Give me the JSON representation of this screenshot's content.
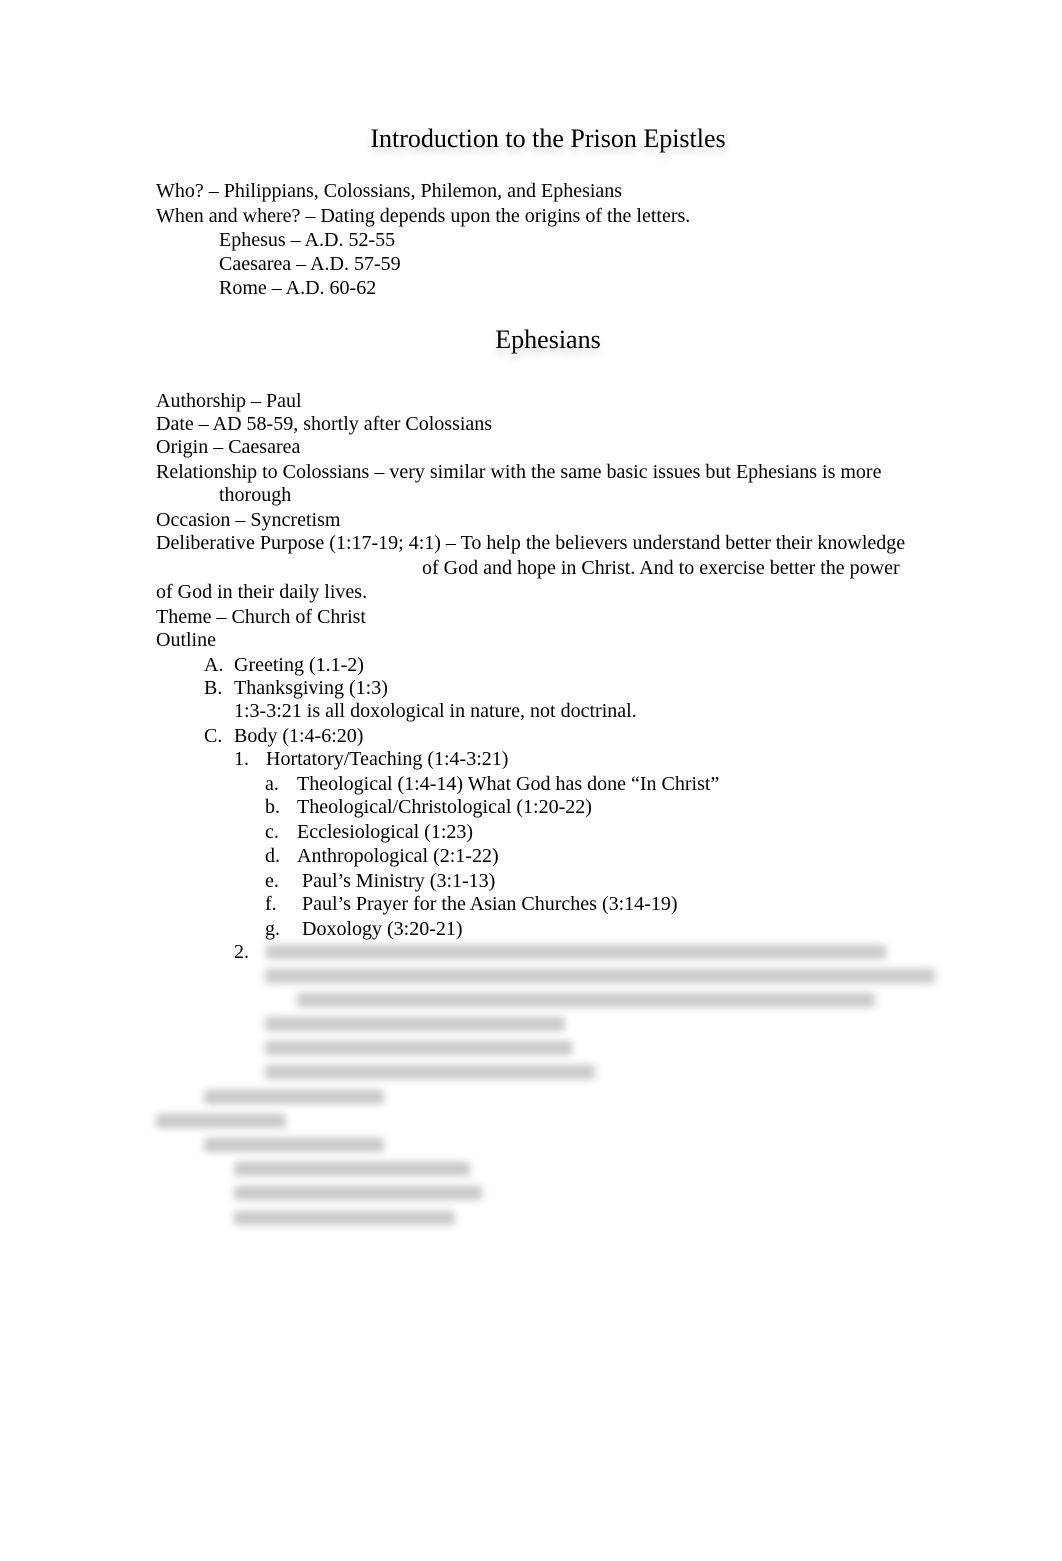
{
  "title": "Introduction to the Prison Epistles",
  "intro": {
    "who": "Who? – Philippians, Colossians, Philemon, and Ephesians",
    "when": "When and where? – Dating depends upon the origins of the letters.",
    "places": [
      "Ephesus – A.D. 52-55",
      "Caesarea – A.D. 57-59",
      "Rome – A.D. 60-62"
    ]
  },
  "section_heading": "Ephesians",
  "details": {
    "authorship": "Authorship – Paul",
    "date": "Date – AD 58-59, shortly after Colossians",
    "origin": "Origin – Caesarea",
    "relationship_1": "Relationship to Colossians – very similar with the same basic issues but Ephesians is more",
    "relationship_2": "thorough",
    "occasion": "Occasion – Syncretism",
    "purpose_1": "Deliberative Purpose (1:17-19; 4:1) – To help the believers understand better their knowledge",
    "purpose_2": "of God and hope in Christ. And to exercise better the power",
    "purpose_3": "of God in their daily lives.",
    "theme": "Theme – Church of Christ",
    "outline": "Outline"
  },
  "outline": {
    "A": {
      "label": "A.",
      "text": "Greeting (1.1-2)"
    },
    "B": {
      "label": "B.",
      "text": "Thanksgiving (1:3)"
    },
    "B_note": "1:3-3:21 is all doxological in nature, not doctrinal.",
    "C": {
      "label": "C.",
      "text": "Body (1:4-6:20)"
    },
    "C1": {
      "label": "1.",
      "text": "Hortatory/Teaching (1:4-3:21)"
    },
    "sub": [
      {
        "label": "a.",
        "text": "Theological (1:4-14) What God has done “In Christ”"
      },
      {
        "label": "b.",
        "text": "Theological/Christological (1:20-22)"
      },
      {
        "label": "c.",
        "text": "Ecclesiological (1:23)"
      },
      {
        "label": "d.",
        "text": "Anthropological (2:1-22)"
      },
      {
        "label": "e.",
        "text": "Paul’s Ministry (3:1-13)"
      },
      {
        "label": "f.",
        "text": "Paul’s Prayer for the Asian Churches (3:14-19)"
      },
      {
        "label": "g.",
        "text": "Doxology (3:20-21)"
      }
    ],
    "C2": {
      "label": "2."
    }
  }
}
